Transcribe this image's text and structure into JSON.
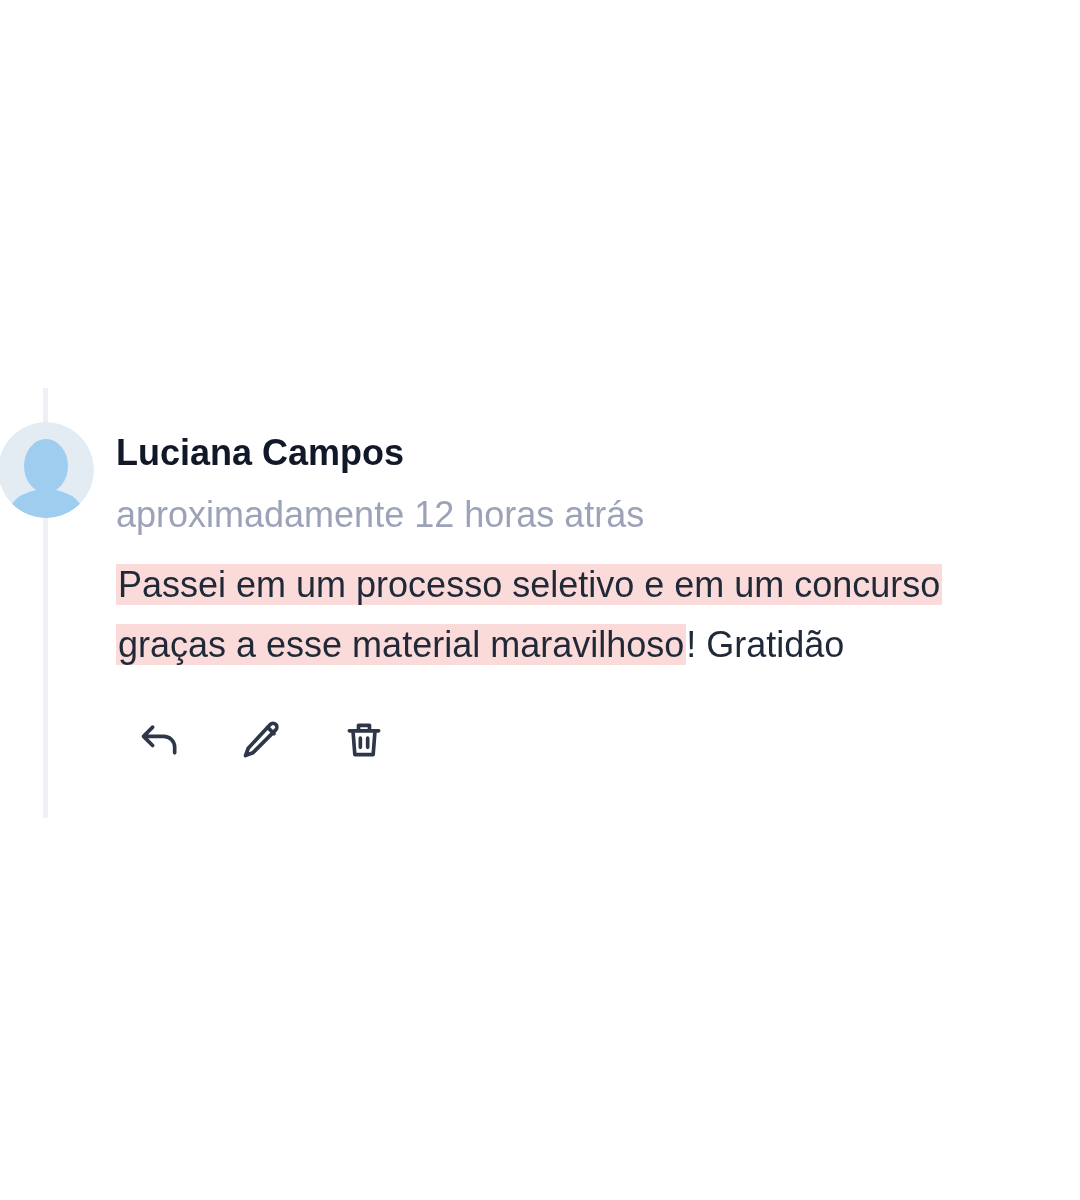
{
  "comment": {
    "author": "Luciana Campos",
    "time": "aproximadamente 12 horas atrás",
    "body": [
      {
        "text": "Passei em um processo seletivo e em um concurso graças a esse material maravilhoso",
        "highlighted": true
      },
      {
        "text": "! Gratidão",
        "highlighted": false
      }
    ],
    "actions": [
      {
        "kind": "reply"
      },
      {
        "kind": "edit"
      },
      {
        "kind": "delete"
      }
    ]
  }
}
